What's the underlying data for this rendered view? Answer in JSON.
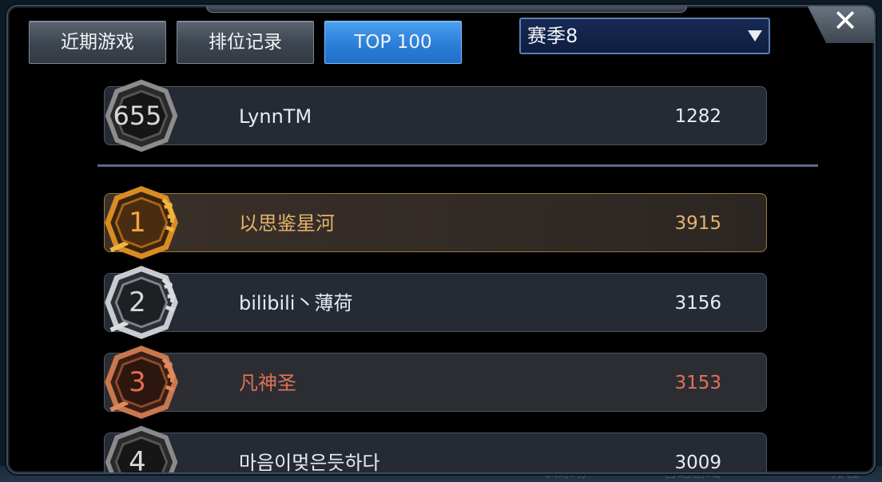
{
  "tabs": [
    {
      "label": "近期游戏",
      "active": false
    },
    {
      "label": "排位记录",
      "active": false
    },
    {
      "label": "TOP 100",
      "active": true
    }
  ],
  "season_select": {
    "value": "赛季8"
  },
  "close_label": "✕",
  "my_rank": {
    "rank": "655",
    "name": "LynnTM",
    "score": "1282"
  },
  "leaderboard": [
    {
      "rank": "1",
      "name": "以思鉴星河",
      "score": "3915",
      "tier": "gold"
    },
    {
      "rank": "2",
      "name": "bilibili丶薄荷",
      "score": "3156",
      "tier": "silver"
    },
    {
      "rank": "3",
      "name": "凡神圣",
      "score": "3153",
      "tier": "bronze"
    },
    {
      "rank": "4",
      "name": "마음이멎은듯하다",
      "score": "3009",
      "tier": "plain"
    }
  ],
  "background_text": [
    "训练场",
    "普通游戏",
    "排位"
  ],
  "colors": {
    "gold": "#e2b36b",
    "bronze": "#e07258",
    "active_tab": "#2b7fd8"
  }
}
